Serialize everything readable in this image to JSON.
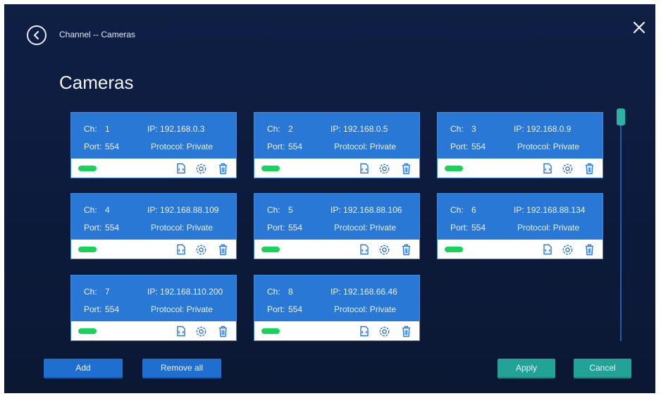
{
  "header": {
    "breadcrumb": "Channel -- Cameras",
    "title": "Cameras"
  },
  "icons": {
    "back": "chevron-left-circle-icon",
    "close": "close-icon",
    "import": "import-file-icon",
    "settings": "gear-icon",
    "delete": "trash-icon"
  },
  "labels": {
    "ch": "Ch:",
    "port": "Port:",
    "ip_prefix": "IP:",
    "protocol_prefix": "Protocol:"
  },
  "cameras": [
    {
      "ch": "1",
      "ip": "192.168.0.3",
      "port": "554",
      "protocol": "Private",
      "status_color": "#18d35a"
    },
    {
      "ch": "2",
      "ip": "192.168.0.5",
      "port": "554",
      "protocol": "Private",
      "status_color": "#18d35a"
    },
    {
      "ch": "3",
      "ip": "192.168.0.9",
      "port": "554",
      "protocol": "Private",
      "status_color": "#18d35a"
    },
    {
      "ch": "4",
      "ip": "192.168.88.109",
      "port": "554",
      "protocol": "Private",
      "status_color": "#18d35a"
    },
    {
      "ch": "5",
      "ip": "192.168.88.106",
      "port": "554",
      "protocol": "Private",
      "status_color": "#18d35a"
    },
    {
      "ch": "6",
      "ip": "192.168.88.134",
      "port": "554",
      "protocol": "Private",
      "status_color": "#18d35a"
    },
    {
      "ch": "7",
      "ip": "192.168.110.200",
      "port": "554",
      "protocol": "Private",
      "status_color": "#18d35a"
    },
    {
      "ch": "8",
      "ip": "192.168.66.46",
      "port": "554",
      "protocol": "Private",
      "status_color": "#18d35a"
    }
  ],
  "footer": {
    "add": "Add",
    "remove_all": "Remove all",
    "apply": "Apply",
    "cancel": "Cancel"
  },
  "colors": {
    "background": "#0d1b3d",
    "card": "#2a78d6",
    "status_online": "#18d35a",
    "primary_button": "#1f6fd0",
    "accent_button": "#22a396"
  }
}
